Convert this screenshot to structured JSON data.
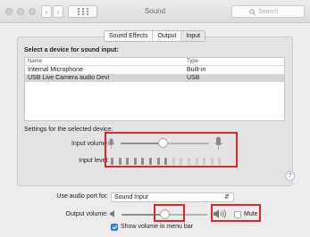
{
  "window": {
    "title": "Sound"
  },
  "toolbar": {
    "search_placeholder": "Search"
  },
  "tabs": [
    {
      "label": "Sound Effects",
      "active": false
    },
    {
      "label": "Output",
      "active": false
    },
    {
      "label": "Input",
      "active": true
    }
  ],
  "input_pane": {
    "heading": "Select a device for sound input:",
    "columns": [
      "Name",
      "Type"
    ],
    "devices": [
      {
        "name": "Internal Microphone",
        "type": "Built-in",
        "selected": false
      },
      {
        "name": "USB  Live  Camera  audio  Devi",
        "type": "USB",
        "selected": true
      }
    ],
    "settings_label": "Settings for the selected device:",
    "input_volume_label": "Input volume:",
    "input_volume_value": 0.48,
    "input_level_label": "Input level:",
    "input_level_active_segments": 8,
    "input_level_total_segments": 15,
    "help_label": "?"
  },
  "bottom": {
    "port_label": "Use audio port for:",
    "port_value": "Sound Input",
    "output_volume_label": "Output volume:",
    "output_volume_value": 0.5,
    "mute_label": "Mute",
    "mute_checked": false,
    "show_volume_label": "Show volume in menu bar",
    "show_volume_checked": true
  },
  "colors": {
    "highlight_box": "#e4242b",
    "level_active": "#8d8d8d",
    "level_inactive": "#cbcbcb",
    "checkbox_accent": "#3b86f3"
  }
}
